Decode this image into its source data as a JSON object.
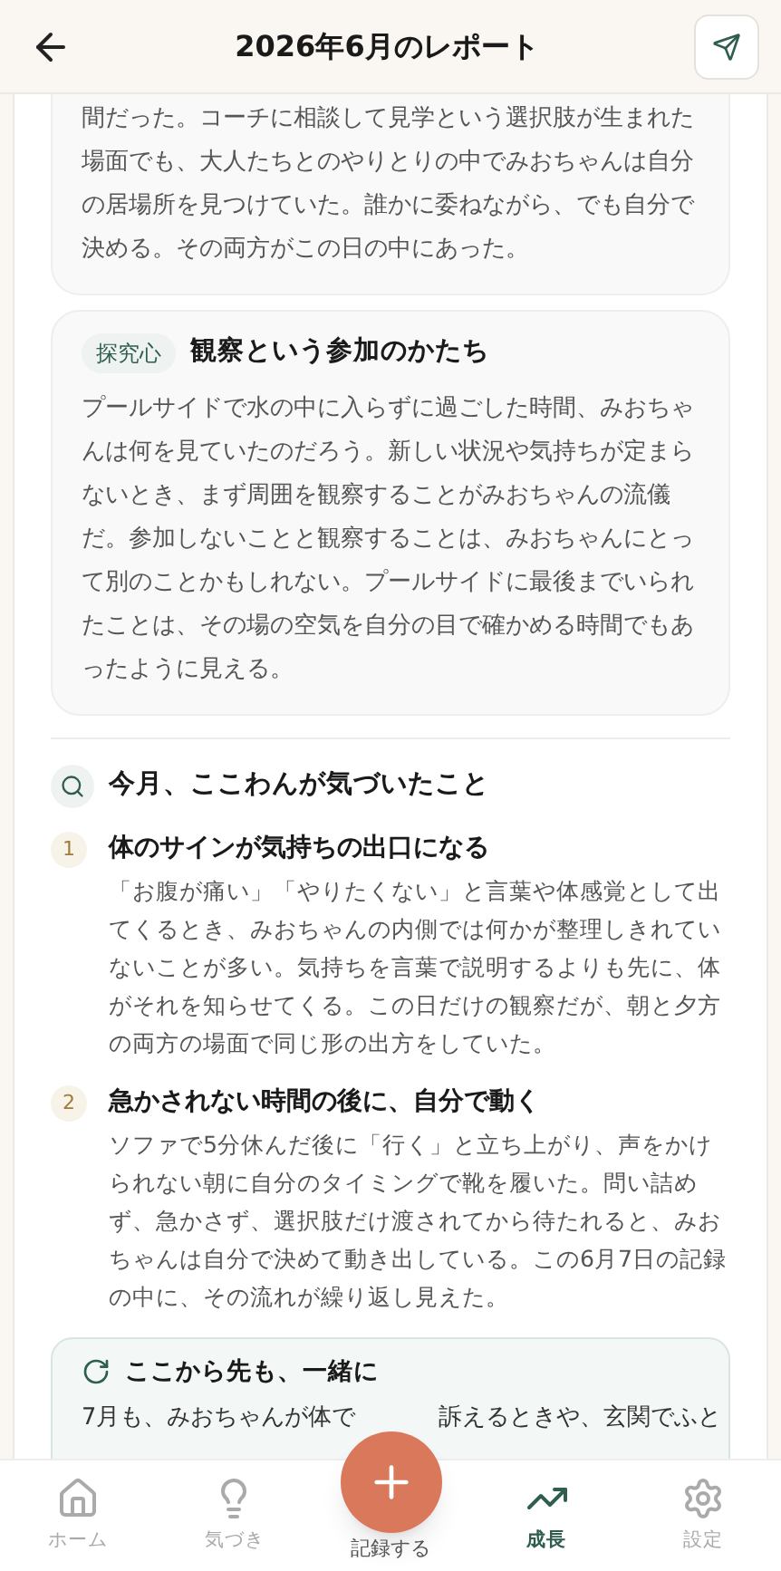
{
  "header": {
    "title": "2026年6月のレポート"
  },
  "intro_card": {
    "text": "間だった。コーチに相談して見学という選択肢が生まれた場面でも、大人たちとのやりとりの中でみおちゃんは自分の居場所を見つけていた。誰かに委ねながら、でも自分で決める。その両方がこの日の中にあった。"
  },
  "theme_card": {
    "tag": "探究心",
    "title": "観察という参加のかたち",
    "text": "プールサイドで水の中に入らずに過ごした時間、みおちゃんは何を見ていたのだろう。新しい状況や気持ちが定まらないとき、まず周囲を観察することがみおちゃんの流儀だ。参加しないことと観察することは、みおちゃんにとって別のことかもしれない。プールサイドに最後までいられたことは、その場の空気を自分の目で確かめる時間でもあったように見える。"
  },
  "findings": {
    "title": "今月、ここわんが気づいたこと",
    "items": [
      {
        "number": "1",
        "title": "体のサインが気持ちの出口になる",
        "text": "「お腹が痛い」「やりたくない」と言葉や体感覚として出てくるとき、みおちゃんの内側では何かが整理しきれていないことが多い。気持ちを言葉で説明するよりも先に、体がそれを知らせてくる。この日だけの観察だが、朝と夕方の両方の場面で同じ形の出方をしていた。"
      },
      {
        "number": "2",
        "title": "急かされない時間の後に、自分で動く",
        "text": "ソファで5分休んだ後に「行く」と立ち上がり、声をかけられない朝に自分のタイミングで靴を履いた。問い詰めず、急かさず、選択肢だけ渡されてから待たれると、みおちゃんは自分で決めて動き出している。この6月7日の記録の中に、その流れが繰り返し見えた。"
      }
    ]
  },
  "next_card": {
    "title": "ここから先も、一緒に",
    "text_parts": [
      "7月も、みおちゃんが体で",
      "訴えるときや、玄関でふと"
    ]
  },
  "nav": [
    {
      "label": "ホーム",
      "kind": "home",
      "selected": false
    },
    {
      "label": "気づき",
      "kind": "bulb",
      "selected": false
    },
    {
      "label": "記録する",
      "kind": "add",
      "selected": false
    },
    {
      "label": "成長",
      "kind": "growth",
      "selected": true
    },
    {
      "label": "設定",
      "kind": "settings",
      "selected": false
    }
  ]
}
